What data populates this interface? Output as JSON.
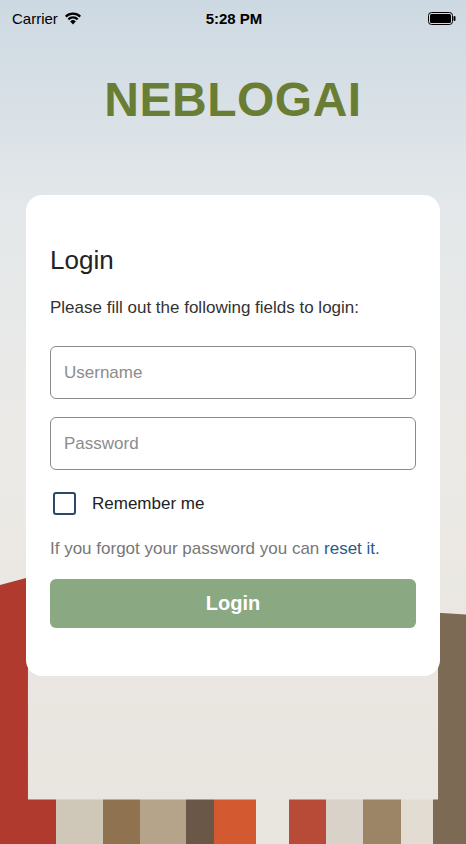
{
  "status_bar": {
    "carrier": "Carrier",
    "time": "5:28 PM"
  },
  "logo": "NEBLOGAI",
  "card": {
    "title": "Login",
    "subtitle": "Please fill out the following fields to login:",
    "fields": [
      {
        "name": "username",
        "placeholder": "Username",
        "type": "text"
      },
      {
        "name": "password",
        "placeholder": "Password",
        "type": "password"
      }
    ],
    "remember": {
      "label": "Remember me",
      "checked": false
    },
    "forgot": {
      "text": "If you forgot your password you can ",
      "link": "reset it."
    },
    "button": "Login"
  }
}
